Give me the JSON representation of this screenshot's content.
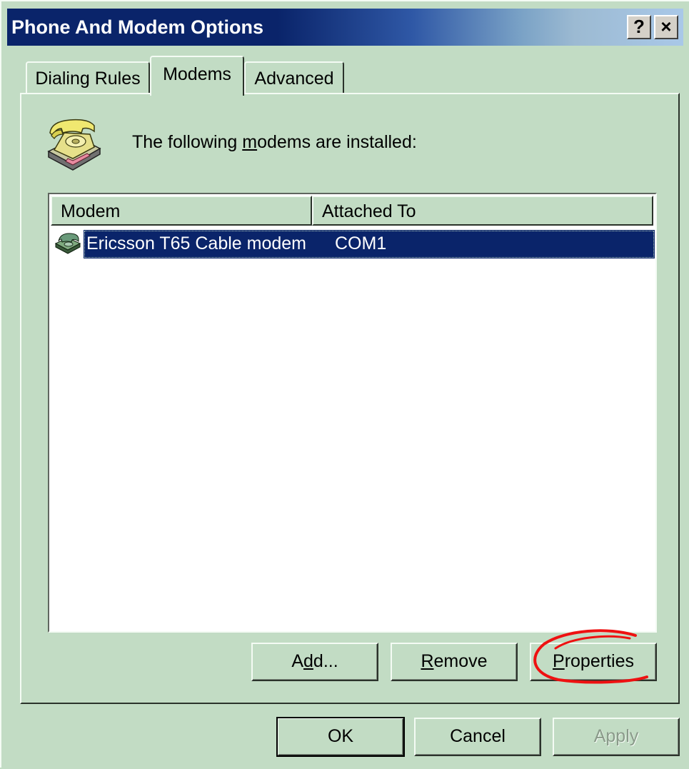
{
  "window": {
    "title": "Phone And Modem Options",
    "help_button": "?",
    "close_button": "×"
  },
  "tabs": [
    {
      "label": "Dialing Rules",
      "selected": false
    },
    {
      "label": "Modems",
      "selected": true
    },
    {
      "label": "Advanced",
      "selected": false
    }
  ],
  "page": {
    "instruction_prefix": "The following ",
    "instruction_mnemonic": "m",
    "instruction_suffix": "odems are  installed:"
  },
  "list": {
    "columns": [
      "Modem",
      "Attached To"
    ],
    "rows": [
      {
        "modem": "Ericsson T65 Cable modem",
        "attached_to": "COM1",
        "selected": true
      }
    ]
  },
  "buttons": {
    "add": {
      "pre": "A",
      "mn": "d",
      "post": "d..."
    },
    "remove": {
      "pre": "",
      "mn": "R",
      "post": "emove"
    },
    "properties": {
      "pre": "",
      "mn": "P",
      "post": "roperties"
    },
    "ok": "OK",
    "cancel": "Cancel",
    "apply": "Apply"
  },
  "colors": {
    "dialog_face": "#c2dcc4",
    "title_bar": "#0a246a",
    "selection": "#0a246a",
    "annotation": "#ee1111"
  },
  "icons": {
    "phone": "telephone-icon",
    "modem": "modem-icon"
  },
  "annotation": "red circle around Properties button"
}
